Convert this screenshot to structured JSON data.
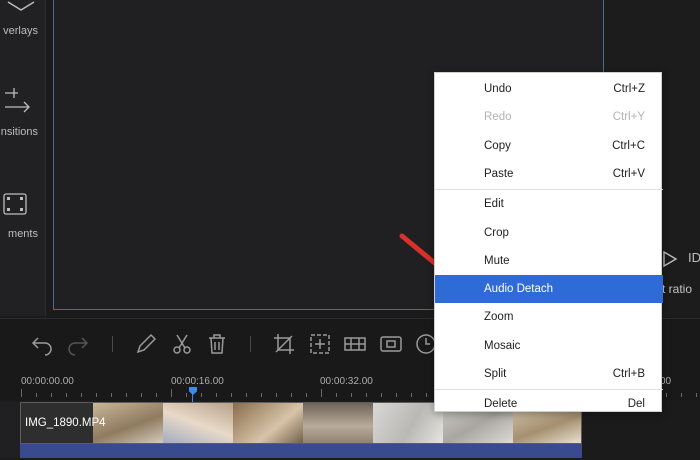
{
  "sidebar": {
    "items": [
      {
        "label": "verlays",
        "icon": "overlays-icon"
      },
      {
        "label": "nsitions",
        "icon": "transitions-icon"
      },
      {
        "label": "ments",
        "icon": "elements-icon"
      }
    ]
  },
  "preview": {
    "aspect_label": "t ratio",
    "play_icon": "play-icon",
    "id_glyph": "ID"
  },
  "toolbar": {
    "icons": [
      "undo-icon",
      "redo-icon",
      "edit-pencil-icon",
      "scissors-icon",
      "delete-icon",
      "crop-icon",
      "zoom-icon",
      "mosaic-icon",
      "frame-icon",
      "speed-icon"
    ]
  },
  "timeline": {
    "timecodes": [
      "00:00:00.00",
      "00:00:16.00",
      "00:00:32.00",
      "00"
    ],
    "clip_name": "IMG_1890.MP4"
  },
  "context_menu": {
    "groups": [
      [
        {
          "label": "Undo",
          "shortcut": "Ctrl+Z",
          "enabled": true
        },
        {
          "label": "Redo",
          "shortcut": "Ctrl+Y",
          "enabled": false
        },
        {
          "label": "Copy",
          "shortcut": "Ctrl+C",
          "enabled": true
        },
        {
          "label": "Paste",
          "shortcut": "Ctrl+V",
          "enabled": true
        }
      ],
      [
        {
          "label": "Edit",
          "shortcut": "",
          "enabled": true
        },
        {
          "label": "Crop",
          "shortcut": "",
          "enabled": true
        },
        {
          "label": "Mute",
          "shortcut": "",
          "enabled": true
        },
        {
          "label": "Audio Detach",
          "shortcut": "",
          "enabled": true,
          "highlighted": true
        },
        {
          "label": "Zoom",
          "shortcut": "",
          "enabled": true
        },
        {
          "label": "Mosaic",
          "shortcut": "",
          "enabled": true
        },
        {
          "label": "Split",
          "shortcut": "Ctrl+B",
          "enabled": true
        }
      ],
      [
        {
          "label": "Delete",
          "shortcut": "Del",
          "enabled": true
        }
      ]
    ]
  },
  "colors": {
    "highlight": "#2f6bd6",
    "playhead": "#3d8bf0",
    "annotation_arrow": "#d9302a",
    "audio_track": "#3a4a8f"
  }
}
